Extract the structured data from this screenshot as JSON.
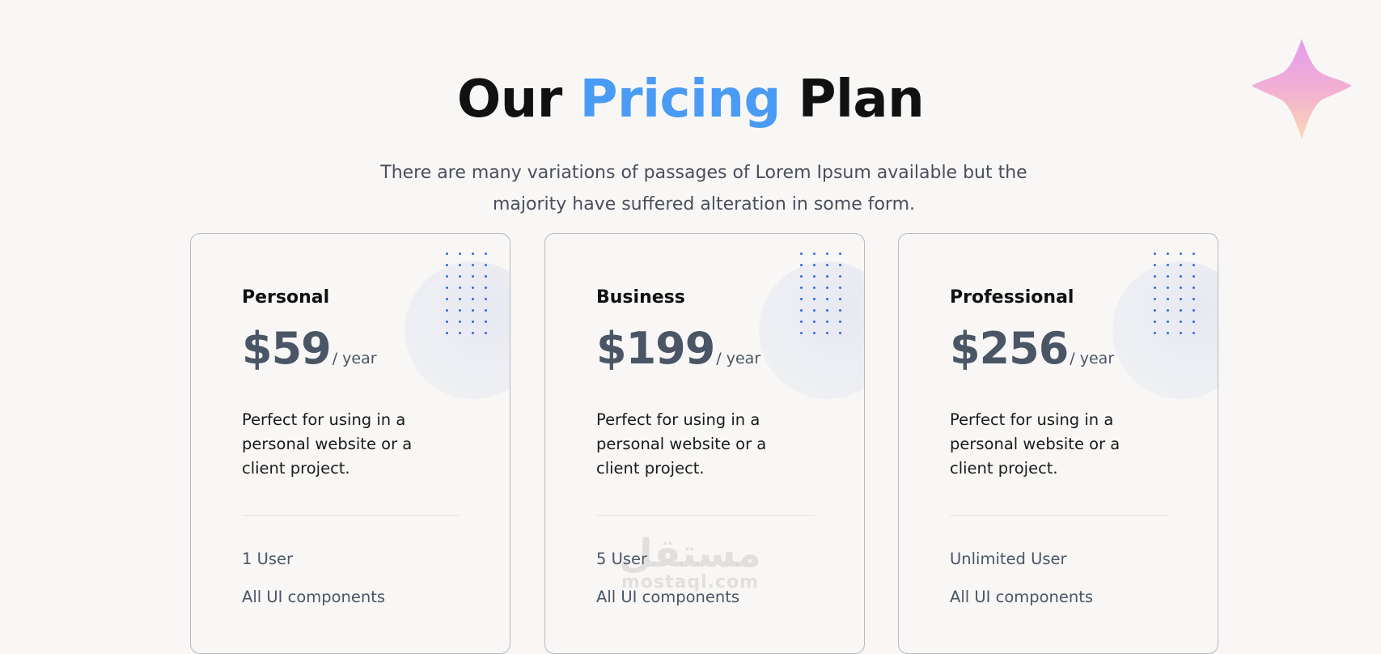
{
  "header": {
    "title_prefix": "Our",
    "title_accent": "Pricing",
    "title_suffix": "Plan",
    "subtitle": "There are many variations of passages of Lorem Ipsum available but the majority have suffered alteration in some form."
  },
  "colors": {
    "accent": "#4a9bf4",
    "price_text": "#4a5566",
    "dots": "#2d6be3",
    "background": "#f8f7f5"
  },
  "plans": [
    {
      "name": "Personal",
      "price": "$59",
      "period": "/ year",
      "description": "Perfect for using in a personal website or a client project.",
      "features": [
        "1 User",
        "All UI components"
      ]
    },
    {
      "name": "Business",
      "price": "$199",
      "period": "/ year",
      "description": "Perfect for using in a personal website or a client project.",
      "features": [
        "5 User",
        "All UI components"
      ]
    },
    {
      "name": "Professional",
      "price": "$256",
      "period": "/ year",
      "description": "Perfect for using in a personal website or a client project.",
      "features": [
        "Unlimited User",
        "All UI components"
      ]
    }
  ],
  "watermark": {
    "main": "مستقل",
    "sub": "mostaql.com"
  },
  "decorations": {
    "sparkle_icon": "four-point-star-icon",
    "dot_grid_icon": "dot-grid-icon"
  }
}
